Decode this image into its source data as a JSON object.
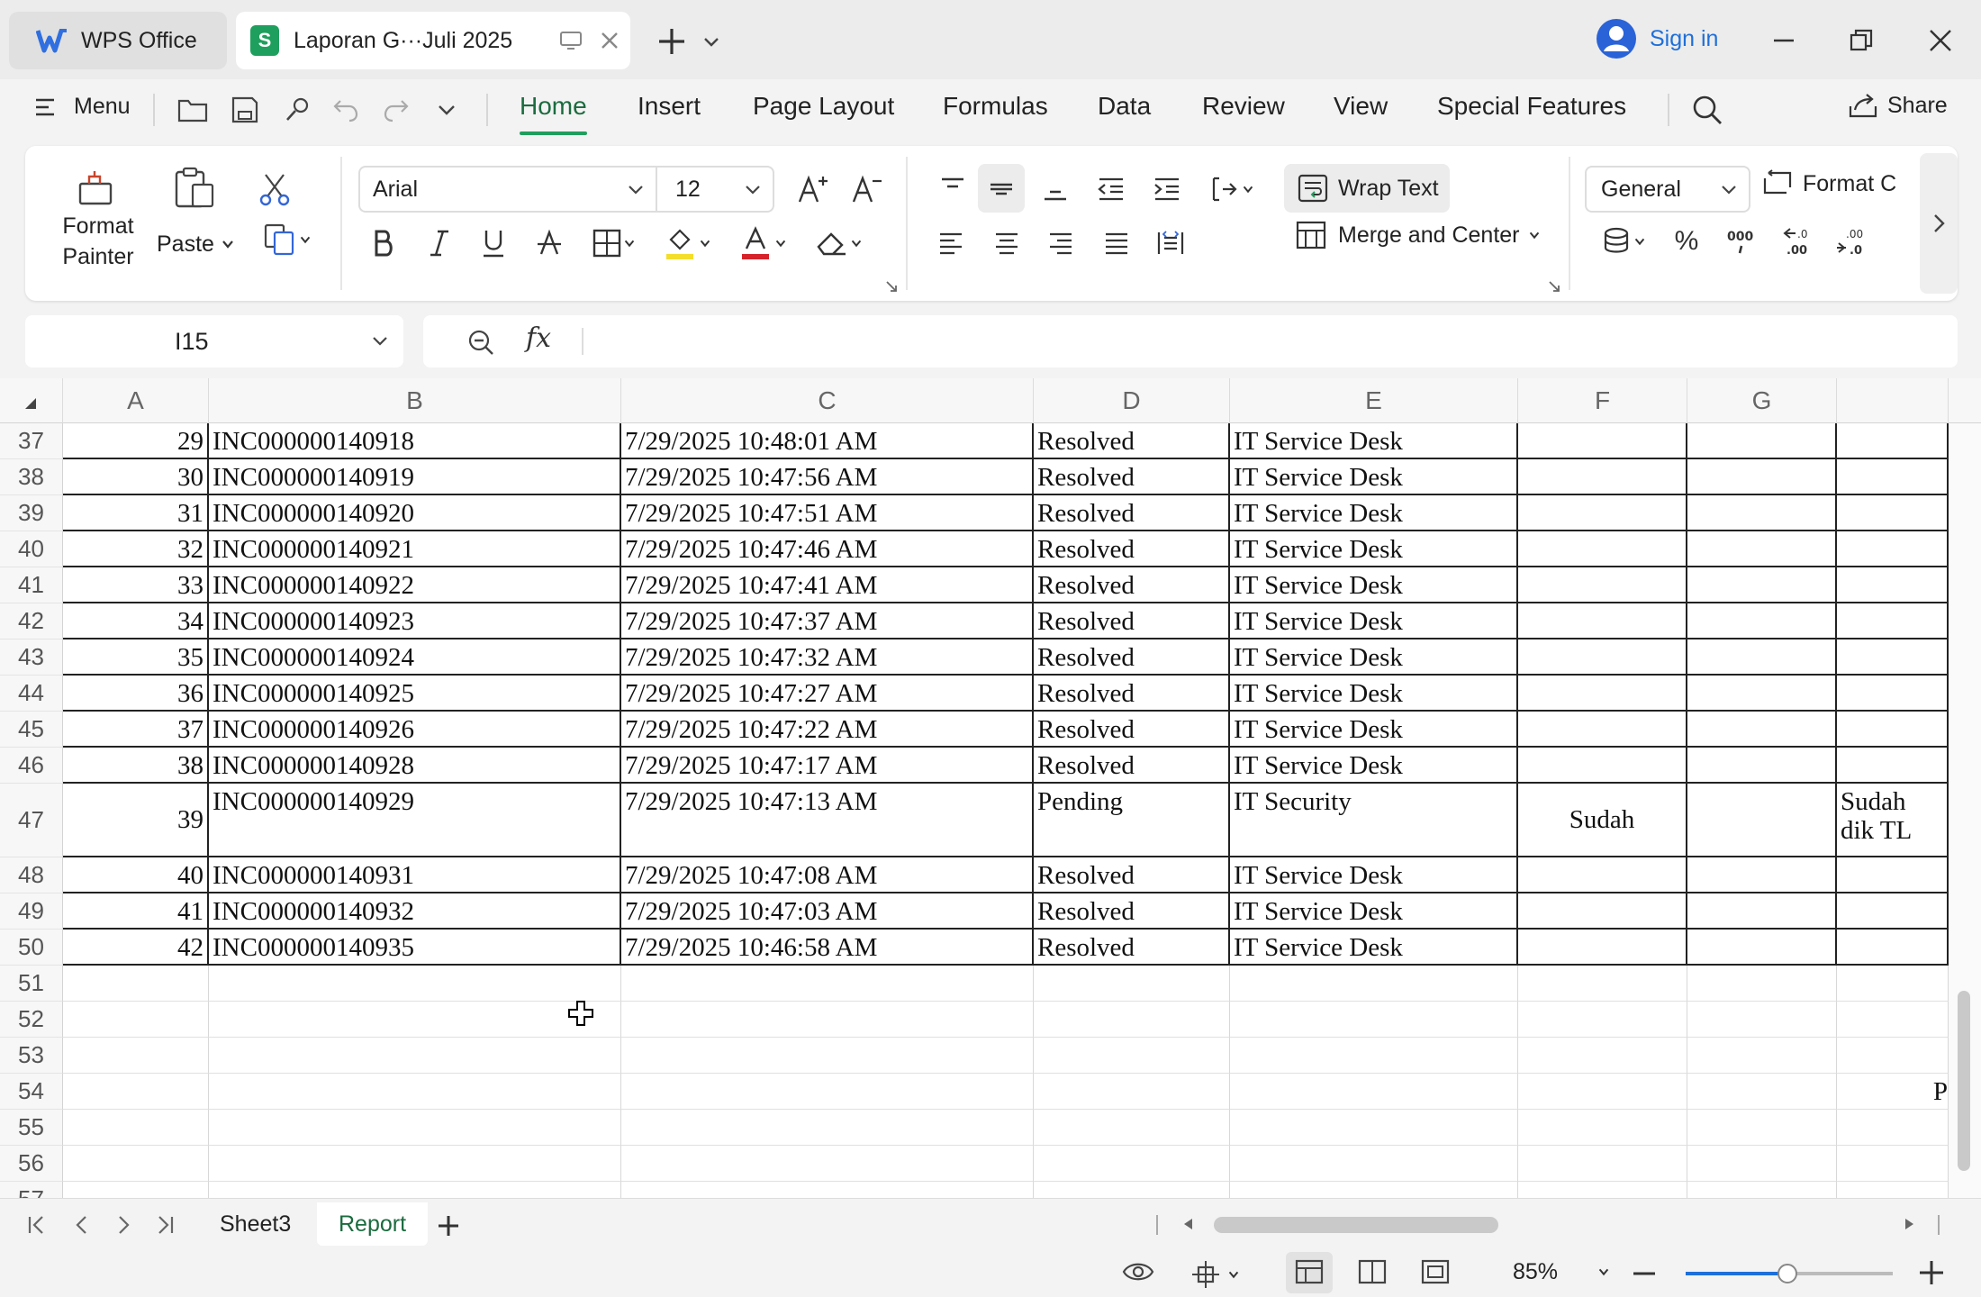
{
  "titlebar": {
    "home_tab": "WPS Office",
    "doc_tab": "Laporan G···Juli 2025",
    "sign_in": "Sign in"
  },
  "menubar": {
    "menu_label": "Menu",
    "tabs": [
      "Home",
      "Insert",
      "Page Layout",
      "Formulas",
      "Data",
      "Review",
      "View",
      "Special Features"
    ],
    "active_tab": "Home",
    "share": "Share"
  },
  "ribbon": {
    "format_painter_1": "Format",
    "format_painter_2": "Painter",
    "paste": "Paste",
    "font_name": "Arial",
    "font_size": "12",
    "wrap_text": "Wrap Text",
    "merge_center": "Merge and Center",
    "number_format": "General",
    "format_cells": "Format C"
  },
  "formula_bar": {
    "cell_ref": "I15",
    "fx": "fx",
    "content": ""
  },
  "grid": {
    "columns": [
      "A",
      "B",
      "C",
      "D",
      "E",
      "F",
      "G",
      ""
    ],
    "rows": [
      {
        "r": "37",
        "a": "29",
        "b": "INC000000140918",
        "c": "7/29/2025 10:48:01 AM",
        "d": "Resolved",
        "e": "IT Service Desk",
        "f": "",
        "g": "",
        "h": ""
      },
      {
        "r": "38",
        "a": "30",
        "b": "INC000000140919",
        "c": "7/29/2025 10:47:56 AM",
        "d": "Resolved",
        "e": "IT Service Desk",
        "f": "",
        "g": "",
        "h": ""
      },
      {
        "r": "39",
        "a": "31",
        "b": "INC000000140920",
        "c": "7/29/2025 10:47:51 AM",
        "d": "Resolved",
        "e": "IT Service Desk",
        "f": "",
        "g": "",
        "h": ""
      },
      {
        "r": "40",
        "a": "32",
        "b": "INC000000140921",
        "c": "7/29/2025 10:47:46 AM",
        "d": "Resolved",
        "e": "IT Service Desk",
        "f": "",
        "g": "",
        "h": ""
      },
      {
        "r": "41",
        "a": "33",
        "b": "INC000000140922",
        "c": "7/29/2025 10:47:41 AM",
        "d": "Resolved",
        "e": "IT Service Desk",
        "f": "",
        "g": "",
        "h": ""
      },
      {
        "r": "42",
        "a": "34",
        "b": "INC000000140923",
        "c": "7/29/2025 10:47:37 AM",
        "d": "Resolved",
        "e": "IT Service Desk",
        "f": "",
        "g": "",
        "h": ""
      },
      {
        "r": "43",
        "a": "35",
        "b": "INC000000140924",
        "c": "7/29/2025 10:47:32 AM",
        "d": "Resolved",
        "e": "IT Service Desk",
        "f": "",
        "g": "",
        "h": ""
      },
      {
        "r": "44",
        "a": "36",
        "b": "INC000000140925",
        "c": "7/29/2025 10:47:27 AM",
        "d": "Resolved",
        "e": "IT Service Desk",
        "f": "",
        "g": "",
        "h": ""
      },
      {
        "r": "45",
        "a": "37",
        "b": "INC000000140926",
        "c": "7/29/2025 10:47:22 AM",
        "d": "Resolved",
        "e": "IT Service Desk",
        "f": "",
        "g": "",
        "h": ""
      },
      {
        "r": "46",
        "a": "38",
        "b": "INC000000140928",
        "c": "7/29/2025 10:47:17 AM",
        "d": "Resolved",
        "e": "IT Service Desk",
        "f": "",
        "g": "",
        "h": ""
      },
      {
        "r": "47",
        "a": "39",
        "b": "INC000000140929",
        "c": "7/29/2025 10:47:13 AM",
        "d": "Pending",
        "e": "IT Security",
        "f": "Sudah",
        "g": "",
        "h": "Sudah dik TL"
      },
      {
        "r": "48",
        "a": "40",
        "b": "INC000000140931",
        "c": "7/29/2025 10:47:08 AM",
        "d": "Resolved",
        "e": "IT Service Desk",
        "f": "",
        "g": "",
        "h": ""
      },
      {
        "r": "49",
        "a": "41",
        "b": "INC000000140932",
        "c": "7/29/2025 10:47:03 AM",
        "d": "Resolved",
        "e": "IT Service Desk",
        "f": "",
        "g": "",
        "h": ""
      },
      {
        "r": "50",
        "a": "42",
        "b": "INC000000140935",
        "c": "7/29/2025 10:46:58 AM",
        "d": "Resolved",
        "e": "IT Service Desk",
        "f": "",
        "g": "",
        "h": ""
      },
      {
        "r": "51",
        "a": "",
        "b": "",
        "c": "",
        "d": "",
        "e": "",
        "f": "",
        "g": "",
        "h": ""
      },
      {
        "r": "52",
        "a": "",
        "b": "",
        "c": "",
        "d": "",
        "e": "",
        "f": "",
        "g": "",
        "h": ""
      },
      {
        "r": "53",
        "a": "",
        "b": "",
        "c": "",
        "d": "",
        "e": "",
        "f": "",
        "g": "",
        "h": ""
      },
      {
        "r": "54",
        "a": "",
        "b": "",
        "c": "",
        "d": "",
        "e": "",
        "f": "",
        "g": "",
        "h": "P"
      },
      {
        "r": "55",
        "a": "",
        "b": "",
        "c": "",
        "d": "",
        "e": "",
        "f": "",
        "g": "",
        "h": ""
      },
      {
        "r": "56",
        "a": "",
        "b": "",
        "c": "",
        "d": "",
        "e": "",
        "f": "",
        "g": "",
        "h": ""
      },
      {
        "r": "57",
        "a": "",
        "b": "",
        "c": "",
        "d": "",
        "e": "",
        "f": "",
        "g": "",
        "h": ""
      }
    ]
  },
  "sheets": {
    "tabs": [
      "Sheet3",
      "Report"
    ],
    "active": "Report"
  },
  "statusbar": {
    "zoom": "85%",
    "zoom_level": 0.85
  },
  "colors": {
    "accent_green": "#1f9f5d",
    "link_blue": "#1e6fd9"
  }
}
